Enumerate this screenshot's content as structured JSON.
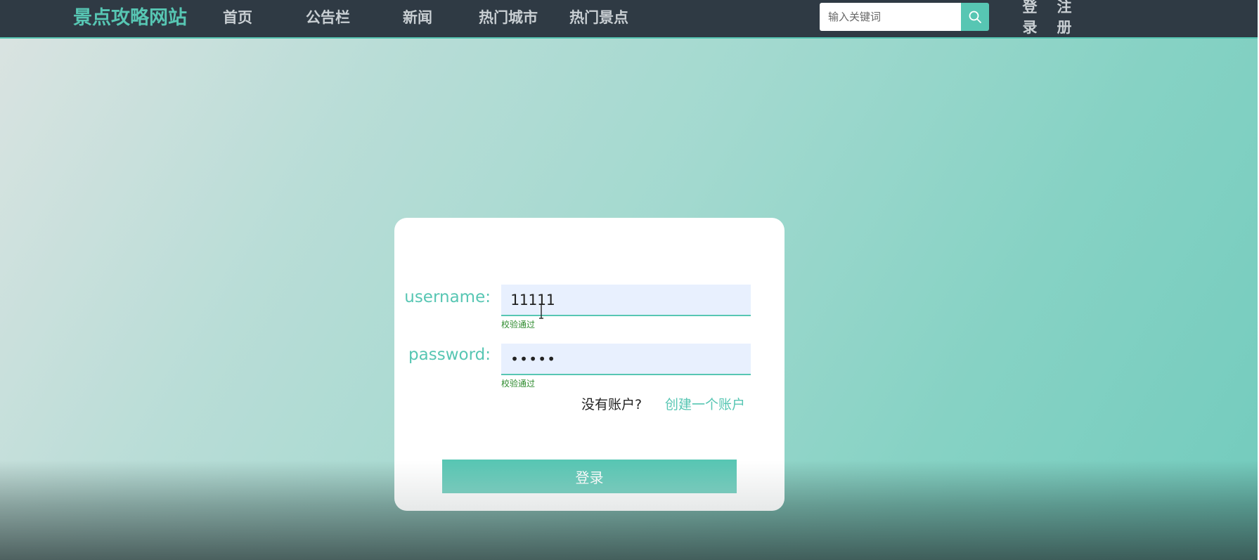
{
  "navbar": {
    "brand": "景点攻略网站",
    "items": [
      {
        "label": "首页"
      },
      {
        "label": "公告栏"
      },
      {
        "label": "新闻"
      },
      {
        "label": "热门城市"
      },
      {
        "label": "热门景点"
      }
    ],
    "search_placeholder": "输入关键词",
    "search_icon": "search-icon",
    "login_label": "登录",
    "register_label": "注册"
  },
  "login_form": {
    "username_label": "username:",
    "username_value": "11111",
    "username_hint": "校验通过",
    "password_label": "password:",
    "password_value": "11111",
    "password_hint": "校验通过",
    "no_account_text": "没有账户?",
    "create_account_link": "创建一个账户",
    "submit_label": "登录"
  },
  "colors": {
    "accent": "#57c6b3",
    "navbar_bg": "#2f3a44",
    "hint_green": "#2e8b2e"
  }
}
